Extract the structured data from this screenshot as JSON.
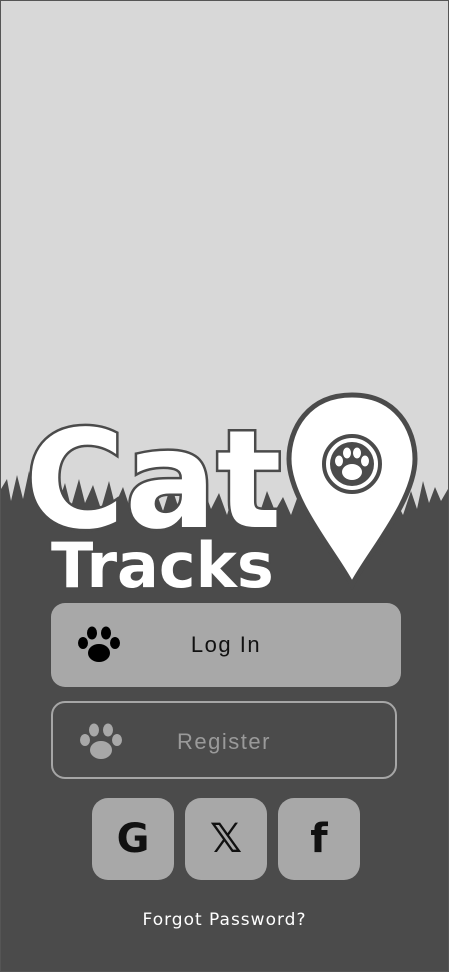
{
  "app": {
    "title_line1": "Cat",
    "title_line2": "Tracks",
    "logo_icon": "map-pin-paw-icon"
  },
  "actions": {
    "login_label": "Log In",
    "register_label": "Register",
    "forgot_password_label": "Forgot Password?"
  },
  "social": [
    {
      "name": "google",
      "glyph": "G",
      "icon": "google-icon"
    },
    {
      "name": "x",
      "glyph": "𝕏",
      "icon": "x-icon"
    },
    {
      "name": "facebook",
      "glyph": "f",
      "icon": "facebook-icon"
    }
  ],
  "colors": {
    "sky": "#d8d8d8",
    "ground": "#4b4b4b",
    "primary_button": "#a8a8a8",
    "outline_button": "#a6a6a6",
    "text_light": "#ffffff"
  }
}
